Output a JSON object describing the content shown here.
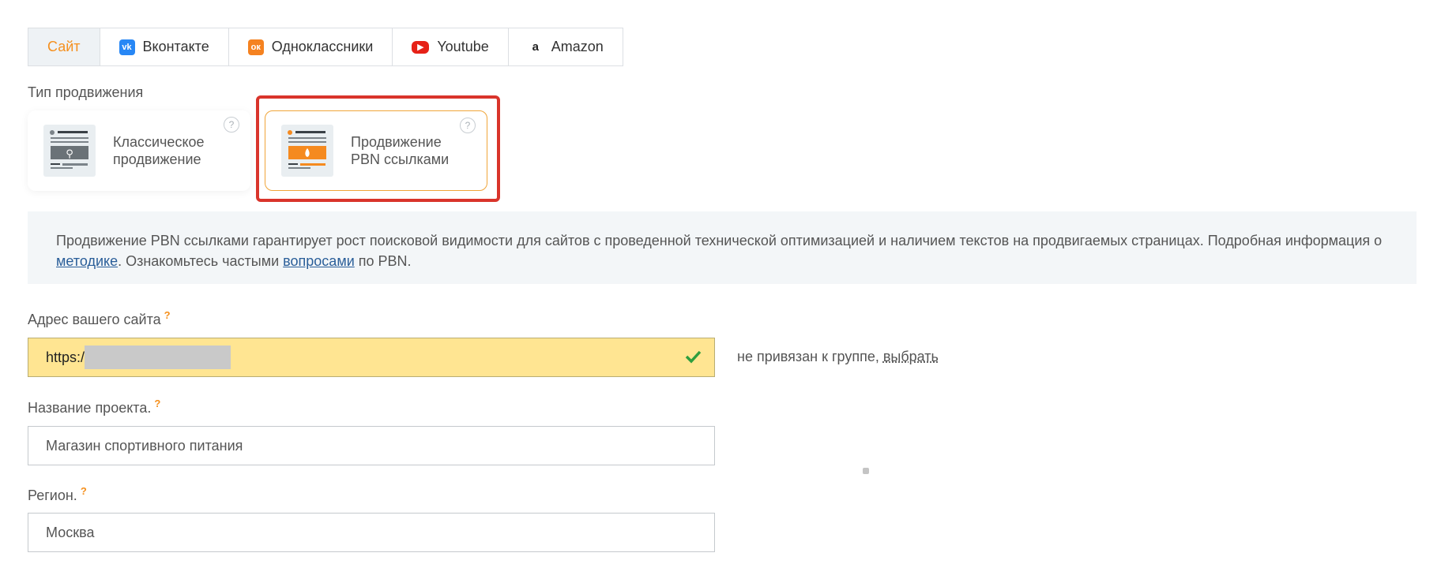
{
  "tabs": [
    {
      "label": "Сайт",
      "icon": ""
    },
    {
      "label": "Вконтакте",
      "icon": "vk-icon"
    },
    {
      "label": "Одноклассники",
      "icon": "ok-icon"
    },
    {
      "label": "Youtube",
      "icon": "youtube-icon"
    },
    {
      "label": "Amazon",
      "icon": "amazon-icon"
    }
  ],
  "promotion": {
    "label": "Тип продвижения",
    "options": [
      {
        "line1": "Классическое",
        "line2": "продвижение"
      },
      {
        "line1": "Продвижение",
        "line2": "PBN ссылками"
      }
    ],
    "help": "?"
  },
  "info": {
    "text_main": "Продвижение PBN ссылками гарантирует рост поисковой видимости для сайтов с проведенной технической оптимизацией и наличием текстов на продвигаемых страницах. Подробная информация о ",
    "link1": "методике",
    "text_mid": ". Ознакомьтесь частыми ",
    "link2": "вопросами",
    "text_end": " по PBN."
  },
  "site": {
    "label": "Адрес вашего сайта",
    "value": "https:/",
    "group_text": "не привязан к группе, ",
    "group_link": "выбрать"
  },
  "project": {
    "label": "Название проекта.",
    "value": "Магазин спортивного питания"
  },
  "region": {
    "label": "Регион.",
    "value": "Москва"
  },
  "hint_mark": "?",
  "colors": {
    "accent": "#f5901e",
    "highlight": "#d9342b",
    "field_valid": "#ffe592",
    "check": "#2e9e3e"
  }
}
